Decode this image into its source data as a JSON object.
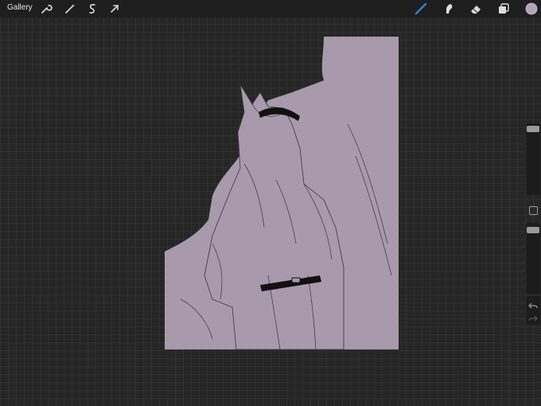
{
  "app": {
    "gallery_label": "Gallery"
  },
  "toolbar": {
    "left_icons": [
      "wrench-icon",
      "magic-wand-icon",
      "selection-icon",
      "transform-arrow-icon"
    ],
    "right_icons": [
      "brush-icon",
      "smudge-icon",
      "eraser-icon",
      "layers-icon",
      "color-swatch"
    ]
  },
  "colors": {
    "brush_accent": "#3a7bd5",
    "active_color": "#b2a3b8",
    "canvas_fill": "#a89aac",
    "background": "#262626"
  }
}
